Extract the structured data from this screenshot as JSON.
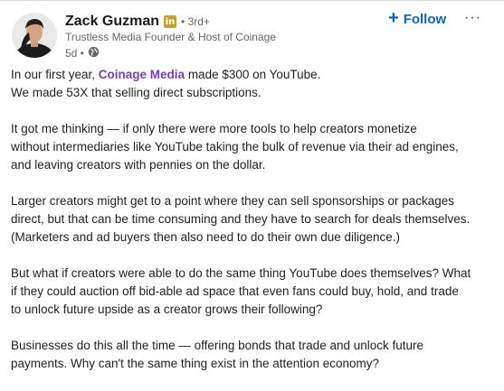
{
  "author": {
    "name": "Zack Guzman",
    "badge": "in",
    "degree": "• 3rd+",
    "headline": "Trustless Media Founder & Host of Coinage",
    "posted": "5d •"
  },
  "actions": {
    "follow_label": "Follow",
    "more_label": "···"
  },
  "post": {
    "p1": {
      "before": "In our first year, ",
      "mention": "Coinage Media",
      "after": " made $300 on YouTube.",
      "line2": "We made 53X that selling direct subscriptions."
    },
    "p2": [
      "It got me thinking — if only there were more tools to help creators monetize",
      "without intermediaries like YouTube taking the bulk of revenue via their ad engines,",
      "and leaving creators with pennies on the dollar."
    ],
    "p3": [
      "Larger creators might get to a point where they can sell sponsorships or packages",
      "direct, but that can be time consuming and they have to search for deals themselves.",
      "(Marketers and ad buyers then also need to do their own due diligence.)"
    ],
    "p4": [
      "But what if creators were able to do the same thing YouTube does themselves? What",
      "if they could auction off bid-able ad space that even fans could buy, hold, and trade",
      "to unlock future upside as a creator grows their following?"
    ],
    "p5": [
      "Businesses do this all the time — offering bonds that trade and unlock future",
      "payments. Why can't the same thing exist in the attention economy?"
    ]
  },
  "colors": {
    "follow": "#0a66c2",
    "mention": "#7a3eb3",
    "badge": "#c9a227"
  },
  "icons": {
    "avatar": "avatar",
    "visibility": "globe-icon",
    "more": "more-options-icon"
  }
}
